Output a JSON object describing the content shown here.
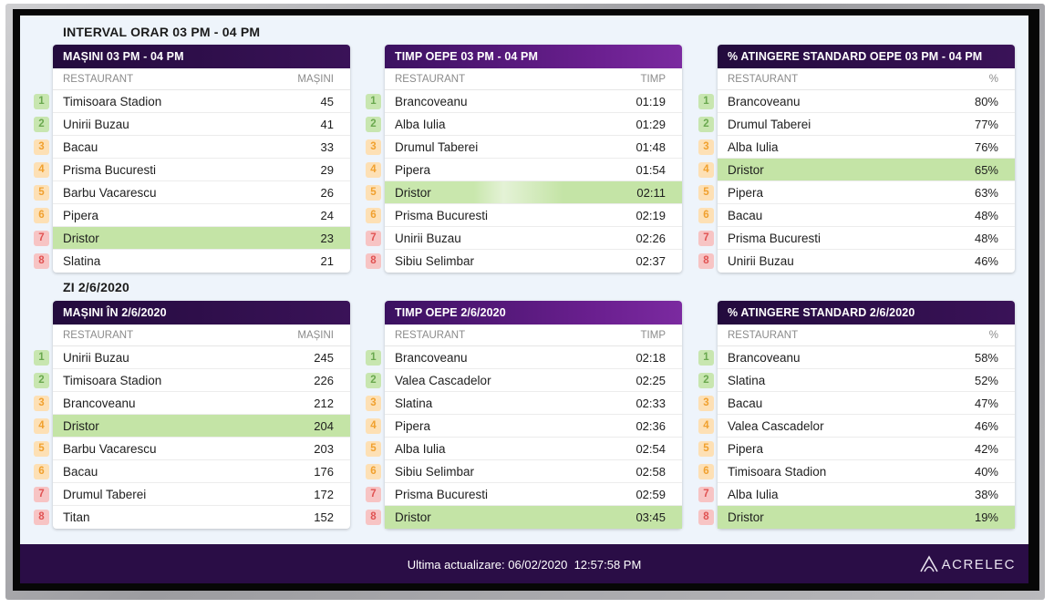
{
  "section1_title": "INTERVAL ORAR 03 PM - 04 PM",
  "section2_title": "ZI 2/6/2020",
  "tables": [
    {
      "title": "MAȘINI 03 PM - 04 PM",
      "col_left": "RESTAURANT",
      "col_right": "MAȘINI",
      "rows": [
        {
          "rank": "1",
          "name": "Timisoara Stadion",
          "value": "45"
        },
        {
          "rank": "2",
          "name": "Unirii Buzau",
          "value": "41"
        },
        {
          "rank": "3",
          "name": "Bacau",
          "value": "33"
        },
        {
          "rank": "4",
          "name": "Prisma Bucuresti",
          "value": "29"
        },
        {
          "rank": "5",
          "name": "Barbu Vacarescu",
          "value": "26"
        },
        {
          "rank": "6",
          "name": "Pipera",
          "value": "24"
        },
        {
          "rank": "7",
          "name": "Dristor",
          "value": "23"
        },
        {
          "rank": "8",
          "name": "Slatina",
          "value": "21"
        }
      ]
    },
    {
      "title": "TIMP OEPE 03 PM - 04 PM",
      "col_left": "RESTAURANT",
      "col_right": "TIMP",
      "rows": [
        {
          "rank": "1",
          "name": "Brancoveanu",
          "value": "01:19"
        },
        {
          "rank": "2",
          "name": "Alba Iulia",
          "value": "01:29"
        },
        {
          "rank": "3",
          "name": "Drumul Taberei",
          "value": "01:48"
        },
        {
          "rank": "4",
          "name": "Pipera",
          "value": "01:54"
        },
        {
          "rank": "5",
          "name": "Dristor",
          "value": "02:11"
        },
        {
          "rank": "6",
          "name": "Prisma Bucuresti",
          "value": "02:19"
        },
        {
          "rank": "7",
          "name": "Unirii Buzau",
          "value": "02:26"
        },
        {
          "rank": "8",
          "name": "Sibiu Selimbar",
          "value": "02:37"
        }
      ]
    },
    {
      "title": "% ATINGERE STANDARD OEPE 03 PM - 04 PM",
      "col_left": "RESTAURANT",
      "col_right": "%",
      "rows": [
        {
          "rank": "1",
          "name": "Brancoveanu",
          "value": "80%"
        },
        {
          "rank": "2",
          "name": "Drumul Taberei",
          "value": "77%"
        },
        {
          "rank": "3",
          "name": "Alba Iulia",
          "value": "76%"
        },
        {
          "rank": "4",
          "name": "Dristor",
          "value": "65%"
        },
        {
          "rank": "5",
          "name": "Pipera",
          "value": "63%"
        },
        {
          "rank": "6",
          "name": "Bacau",
          "value": "48%"
        },
        {
          "rank": "7",
          "name": "Prisma Bucuresti",
          "value": "48%"
        },
        {
          "rank": "8",
          "name": "Unirii Buzau",
          "value": "46%"
        }
      ]
    },
    {
      "title": "MAȘINI ÎN 2/6/2020",
      "col_left": "RESTAURANT",
      "col_right": "MAȘINI",
      "rows": [
        {
          "rank": "1",
          "name": "Unirii Buzau",
          "value": "245"
        },
        {
          "rank": "2",
          "name": "Timisoara Stadion",
          "value": "226"
        },
        {
          "rank": "3",
          "name": "Brancoveanu",
          "value": "212"
        },
        {
          "rank": "4",
          "name": "Dristor",
          "value": "204"
        },
        {
          "rank": "5",
          "name": "Barbu Vacarescu",
          "value": "203"
        },
        {
          "rank": "6",
          "name": "Bacau",
          "value": "176"
        },
        {
          "rank": "7",
          "name": "Drumul Taberei",
          "value": "172"
        },
        {
          "rank": "8",
          "name": "Titan",
          "value": "152"
        }
      ]
    },
    {
      "title": "TIMP OEPE 2/6/2020",
      "col_left": "RESTAURANT",
      "col_right": "TIMP",
      "rows": [
        {
          "rank": "1",
          "name": "Brancoveanu",
          "value": "02:18"
        },
        {
          "rank": "2",
          "name": "Valea Cascadelor",
          "value": "02:25"
        },
        {
          "rank": "3",
          "name": "Slatina",
          "value": "02:33"
        },
        {
          "rank": "4",
          "name": "Pipera",
          "value": "02:36"
        },
        {
          "rank": "5",
          "name": "Alba Iulia",
          "value": "02:54"
        },
        {
          "rank": "6",
          "name": "Sibiu Selimbar",
          "value": "02:58"
        },
        {
          "rank": "7",
          "name": "Prisma Bucuresti",
          "value": "02:59"
        },
        {
          "rank": "8",
          "name": "Dristor",
          "value": "03:45"
        }
      ]
    },
    {
      "title": "% ATINGERE STANDARD 2/6/2020",
      "col_left": "RESTAURANT",
      "col_right": "%",
      "rows": [
        {
          "rank": "1",
          "name": "Brancoveanu",
          "value": "58%"
        },
        {
          "rank": "2",
          "name": "Slatina",
          "value": "52%"
        },
        {
          "rank": "3",
          "name": "Bacau",
          "value": "47%"
        },
        {
          "rank": "4",
          "name": "Valea Cascadelor",
          "value": "46%"
        },
        {
          "rank": "5",
          "name": "Pipera",
          "value": "42%"
        },
        {
          "rank": "6",
          "name": "Timisoara Stadion",
          "value": "40%"
        },
        {
          "rank": "7",
          "name": "Alba Iulia",
          "value": "38%"
        },
        {
          "rank": "8",
          "name": "Dristor",
          "value": "19%"
        }
      ]
    }
  ],
  "highlighted_restaurant": "Dristor",
  "footer": {
    "label": "Ultima actualizare:",
    "date": "06/02/2020",
    "time": "12:57:58 PM",
    "logo_text": "ACRELEC"
  },
  "colors": {
    "header_dark": "#2a0f45",
    "header_purple": "#6a1f8f",
    "highlight": "#c4e4a6",
    "rank_top": "#c8e6b0",
    "rank_mid": "#fde0b5",
    "rank_low": "#f7c4c4"
  }
}
